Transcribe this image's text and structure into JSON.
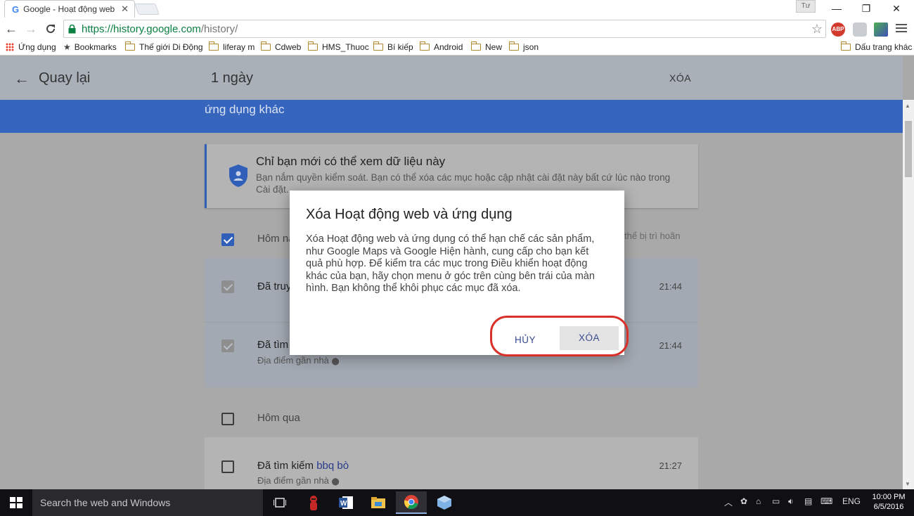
{
  "browser": {
    "tab_title": "Google - Hoạt động web",
    "tab_favicon": "G",
    "profile_name": "Tư",
    "url_scheme_host": "https://history.google.com",
    "url_path": "/history/",
    "extensions": [
      "ABP"
    ],
    "bookmarks": [
      {
        "label": "Ứng dụng",
        "icon": "apps-grid-icon"
      },
      {
        "label": "Bookmarks",
        "icon": "star-icon"
      },
      {
        "label": "Thế giới Di Động",
        "icon": "folder-icon"
      },
      {
        "label": "liferay m",
        "icon": "folder-icon"
      },
      {
        "label": "Cdweb",
        "icon": "folder-icon"
      },
      {
        "label": "HMS_Thuoc",
        "icon": "folder-icon"
      },
      {
        "label": "Bí kiếp",
        "icon": "folder-icon"
      },
      {
        "label": "Android",
        "icon": "folder-icon"
      },
      {
        "label": "New",
        "icon": "folder-icon"
      },
      {
        "label": "json",
        "icon": "folder-icon"
      }
    ],
    "other_bookmarks": "Dấu trang khác"
  },
  "header": {
    "back_label": "Quay lại",
    "range_label": "1 ngày",
    "delete_label": "XÓA"
  },
  "band_text": "ứng dụng khác",
  "privacy": {
    "title": "Chỉ bạn mới có thể xem dữ liệu này",
    "text": "Bạn nắm quyền kiểm soát. Bạn có thể xóa các mục hoặc cập nhật cài đặt này bất cứ lúc nào trong Cài đặt."
  },
  "today": {
    "label": "Hôm na",
    "defer_text": "thể bị trì hoãn",
    "items": [
      {
        "title": "Đã truy",
        "query": "",
        "sub": "",
        "time": "21:44"
      },
      {
        "title": "Đã tìm",
        "query": "",
        "sub": "Địa điểm gần nhà",
        "time": "21:44"
      }
    ]
  },
  "yesterday": {
    "label": "Hôm qua",
    "items": [
      {
        "title": "Đã tìm kiếm ",
        "query": "bbq bò",
        "sub": "Địa điểm gần nhà",
        "time": "21:27"
      }
    ]
  },
  "dialog": {
    "title": "Xóa Hoạt động web và ứng dụng",
    "body": "Xóa Hoạt động web và ứng dụng có thể hạn chế các sản phẩm, như Google Maps và Google Hiện hành, cung cấp cho bạn kết quả phù hợp. Để kiểm tra các mục trong Điều khiển hoạt động khác của bạn, hãy chọn menu ở góc trên cùng bên trái của màn hình. Bạn không thể khôi phục các mục đã xóa.",
    "cancel_label": "HỦY",
    "delete_label": "XÓA"
  },
  "taskbar": {
    "search_placeholder": "Search the web and Windows",
    "language": "ENG",
    "time": "10:00 PM",
    "date": "6/5/2016"
  },
  "colors": {
    "accent_blue": "#3565bd",
    "highlight_red": "#d9302b"
  }
}
